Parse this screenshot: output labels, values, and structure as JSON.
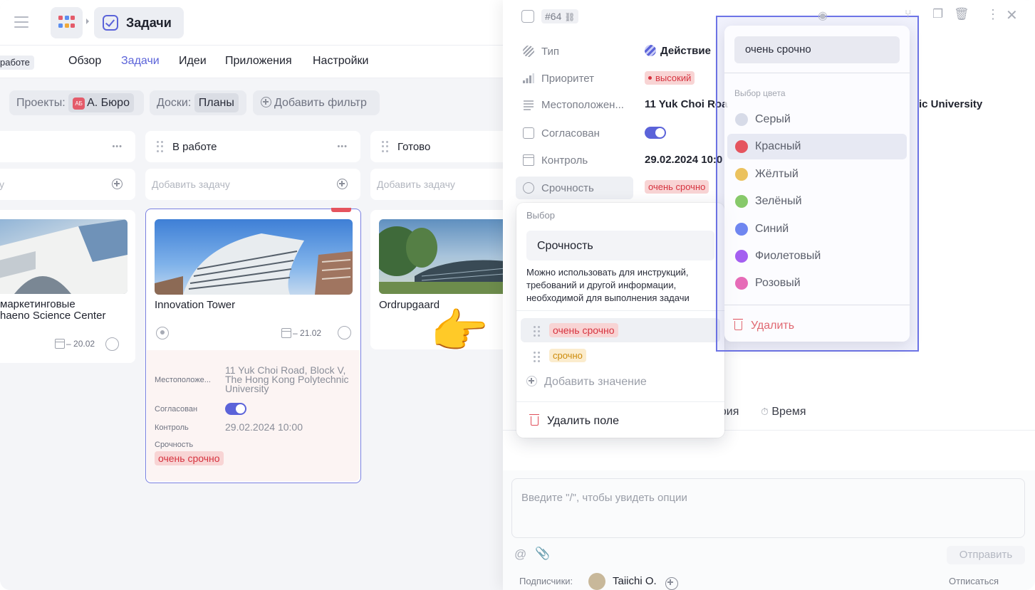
{
  "breadcrumb": {
    "section": "Задачи"
  },
  "subnav": {
    "status_chip": "работе",
    "tabs": [
      "Обзор",
      "Задачи",
      "Идеи",
      "Приложения",
      "Настройки"
    ],
    "active_tab": "Задачи"
  },
  "filters": {
    "projects_label": "Проекты:",
    "projects_avatar": "АБ",
    "projects_value": "А. Бюро",
    "boards_label": "Доски:",
    "boards_value": "Планы",
    "add_filter": "Добавить фильтр"
  },
  "columns": [
    {
      "title": "",
      "add_placeholder": "у"
    },
    {
      "title": "В работе",
      "add_placeholder": "Добавить задачу"
    },
    {
      "title": "Готово",
      "add_placeholder": "Добавить задачу"
    }
  ],
  "cards": {
    "left": {
      "title_line1": "маркетинговые",
      "title_line2": "haeno Science Center",
      "date": "20.02"
    },
    "middle": {
      "title": "Innovation Tower",
      "date": "21.02",
      "props": {
        "location_label": "Местоположе...",
        "location_value": "11 Yuk Choi Road, Block V, The Hong Kong Polytechnic University",
        "approved_label": "Согласован",
        "control_label": "Контроль",
        "control_value": "29.02.2024 10:00",
        "urgency_label": "Срочность",
        "urgency_value": "очень срочно"
      }
    },
    "right": {
      "title": "Ordrupgaard"
    }
  },
  "panel": {
    "task_id": "#64",
    "props": [
      {
        "label": "Тип",
        "value": "Действие"
      },
      {
        "label": "Приоритет",
        "value": "высокий"
      },
      {
        "label": "Местоположен...",
        "value": "11 Yuk Choi Roa",
        "value_tail": "ic University"
      },
      {
        "label": "Согласован",
        "value": ""
      },
      {
        "label": "Контроль",
        "value": "29.02.2024 10:0"
      },
      {
        "label": "Срочность",
        "value": "очень срочно"
      }
    ],
    "bottom_tabs": {
      "history": "ория",
      "time": "Время"
    },
    "comment_placeholder": "Введите \"/\", чтобы увидеть опции",
    "send": "Отправить",
    "subscribers_label": "Подписчики:",
    "subscriber": "Taiichi O.",
    "unsubscribe": "Отписаться"
  },
  "field_menu": {
    "caption": "Выбор",
    "name": "Срочность",
    "hint": "Можно использовать для инструкций, требований и другой информации, необходимой для выполнения задачи",
    "options": [
      "очень срочно",
      "срочно"
    ],
    "add_value": "Добавить значение",
    "delete_field": "Удалить поле"
  },
  "color_picker": {
    "search_value": "очень срочно",
    "caption": "Выбор цвета",
    "colors": [
      {
        "name": "Серый",
        "hex": "#d7dbe8"
      },
      {
        "name": "Красный",
        "hex": "#e5545e"
      },
      {
        "name": "Жёлтый",
        "hex": "#ebc25e"
      },
      {
        "name": "Зелёный",
        "hex": "#87c96a"
      },
      {
        "name": "Синий",
        "hex": "#6f86f0"
      },
      {
        "name": "Фиолетовый",
        "hex": "#a45ff0"
      },
      {
        "name": "Розовый",
        "hex": "#e66bb7"
      }
    ],
    "selected": "Красный",
    "delete": "Удалить"
  },
  "colors": {
    "accent": "#5b63d9",
    "danger": "#e04e5a",
    "selection_frame": "#6d74e6"
  }
}
